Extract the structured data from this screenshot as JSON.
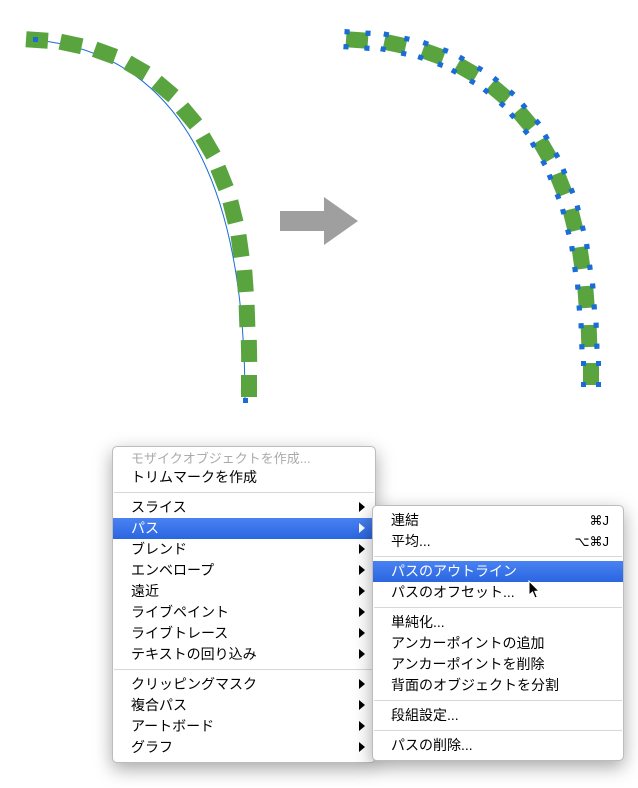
{
  "illustration": {
    "arrow_color": "#9f9f9f",
    "dash_fill": "#5aa440",
    "dash_stroke": "#1a6dd6",
    "path_stroke": "#1a6dd6"
  },
  "menu_main": {
    "clipped_top": "モザイクオブジェクトを作成...",
    "items": [
      {
        "label": "トリムマークを作成",
        "submenu": false
      },
      {
        "sep": true
      },
      {
        "label": "スライス",
        "submenu": true
      },
      {
        "label": "パス",
        "submenu": true,
        "selected": true
      },
      {
        "label": "ブレンド",
        "submenu": true
      },
      {
        "label": "エンベロープ",
        "submenu": true
      },
      {
        "label": "遠近",
        "submenu": true
      },
      {
        "label": "ライブペイント",
        "submenu": true
      },
      {
        "label": "ライブトレース",
        "submenu": true
      },
      {
        "label": "テキストの回り込み",
        "submenu": true
      },
      {
        "sep": true
      },
      {
        "label": "クリッピングマスク",
        "submenu": true
      },
      {
        "label": "複合パス",
        "submenu": true
      },
      {
        "label": "アートボード",
        "submenu": true
      },
      {
        "label": "グラフ",
        "submenu": true
      }
    ]
  },
  "menu_sub": {
    "items": [
      {
        "label": "連結",
        "shortcut": "⌘J"
      },
      {
        "label": "平均...",
        "shortcut": "⌥⌘J"
      },
      {
        "sep": true
      },
      {
        "label": "パスのアウトライン",
        "selected": true
      },
      {
        "label": "パスのオフセット..."
      },
      {
        "sep": true
      },
      {
        "label": "単純化..."
      },
      {
        "label": "アンカーポイントの追加"
      },
      {
        "label": "アンカーポイントを削除"
      },
      {
        "label": "背面のオブジェクトを分割"
      },
      {
        "sep": true
      },
      {
        "label": "段組設定..."
      },
      {
        "sep": true
      },
      {
        "label": "パスの削除..."
      }
    ]
  }
}
